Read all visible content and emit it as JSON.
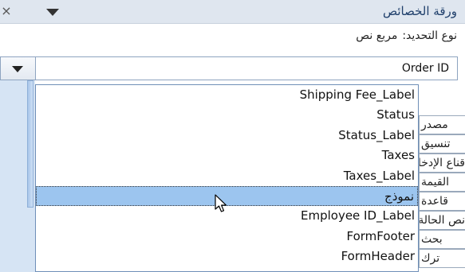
{
  "titlebar": {
    "title": "ورقة الخصائص",
    "close_glyph": "×",
    "menu_icon": "dropdown-arrow-icon"
  },
  "selection": {
    "label": "نوع التحديد:",
    "value": "مربع نص"
  },
  "combo": {
    "value": "Order ID"
  },
  "dropdown": {
    "items": [
      {
        "label": "Shipping Fee_Label"
      },
      {
        "label": "Status"
      },
      {
        "label": "Status_Label"
      },
      {
        "label": "Taxes"
      },
      {
        "label": "Taxes_Label"
      },
      {
        "label": "نموذج",
        "selected": true
      },
      {
        "label": "Employee ID_Label"
      },
      {
        "label": "FormFooter"
      },
      {
        "label": "FormHeader"
      }
    ]
  },
  "tabs": [
    "مصدر",
    "تنسيق",
    "قناع الإدخال",
    "القيمة",
    "قاعدة",
    "نص الحالة",
    "بحث",
    "ترك"
  ],
  "colors": {
    "title_bar": "#dfe6ef",
    "title_text": "#1f3f6b",
    "selection_highlight": "#9cc5ef",
    "side_panel": "#d6e4f4"
  }
}
